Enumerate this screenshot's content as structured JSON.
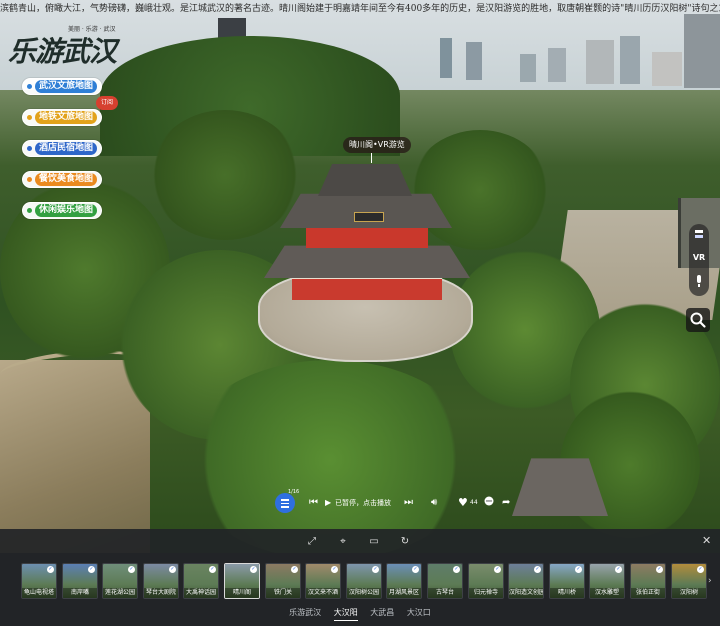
{
  "marquee": "滨鹤青山，俯瞰大江，气势磅礴，巍峨壮观。是江城武汉的著名古迹。晴川阁始建于明嘉靖年间至今有400多年的历史，是汉阳游览的胜地，取唐朝崔颢的诗\"晴川历历汉阳树\"诗句之意命名。有\"三楚胜景\"\"千古巨观\"之美称。荣",
  "logo": {
    "main": "乐游武汉",
    "sub": "美丽 · 乐游 · 武汉"
  },
  "map_buttons": [
    {
      "label": "武汉文旅地图",
      "color": "#2f7fd6"
    },
    {
      "label": "地铁文旅地图",
      "color": "#e2a21b"
    },
    {
      "label": "酒店民宿地图",
      "color": "#2e66c9"
    },
    {
      "label": "餐饮美食地图",
      "color": "#ea8a1f"
    },
    {
      "label": "休闲娱乐地图",
      "color": "#33a041"
    }
  ],
  "new_badge": "订阅",
  "hotspot": "晴川阁•VR游览",
  "right_tools": [
    "layers-icon",
    "VR",
    "audio-guide-icon"
  ],
  "player": {
    "track_badge": "1/16",
    "status": "已暂停，点击播放",
    "likes": "44"
  },
  "thumbnails": [
    {
      "caption": "龟山电视塔",
      "hue": "#6c8fb0"
    },
    {
      "caption": "南岸嘴",
      "hue": "#5b7fb4"
    },
    {
      "caption": "莲花湖公园",
      "hue": "#6f8e7a"
    },
    {
      "caption": "琴台大剧院",
      "hue": "#7c8aa3"
    },
    {
      "caption": "大禹神话园",
      "hue": "#6a8461"
    },
    {
      "caption": "晴川阁",
      "hue": "#8a9aa8"
    },
    {
      "caption": "铁门关",
      "hue": "#8c7a63"
    },
    {
      "caption": "汉文来不酒",
      "hue": "#a08a6b"
    },
    {
      "caption": "汉阳树公园",
      "hue": "#7e96ad"
    },
    {
      "caption": "月湖风景区",
      "hue": "#6b8fb7"
    },
    {
      "caption": "古琴台",
      "hue": "#5e7d6a"
    },
    {
      "caption": "归元禅寺",
      "hue": "#7a8c6c"
    },
    {
      "caption": "汉阳造文创园",
      "hue": "#6d7f99"
    },
    {
      "caption": "晴川桥",
      "hue": "#86a7c7"
    },
    {
      "caption": "汉水雕塑",
      "hue": "#97a3ab"
    },
    {
      "caption": "张伯正街",
      "hue": "#8d7b62"
    },
    {
      "caption": "汉阳树",
      "hue": "#b28c3c"
    }
  ],
  "categories": [
    {
      "label": "乐游武汉",
      "active": false
    },
    {
      "label": "大汉阳",
      "active": true
    },
    {
      "label": "大武昌",
      "active": false
    },
    {
      "label": "大汉口",
      "active": false
    }
  ]
}
